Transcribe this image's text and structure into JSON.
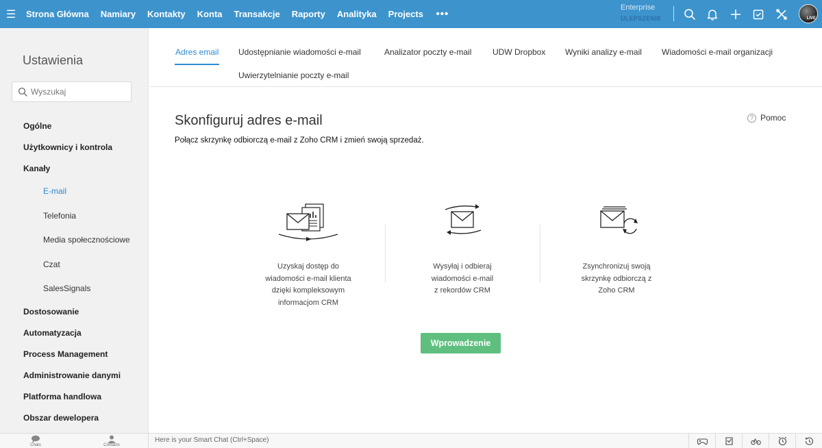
{
  "topnav": {
    "items": [
      "Strona Główna",
      "Namiary",
      "Kontakty",
      "Konta",
      "Transakcje",
      "Raporty",
      "Analityka",
      "Projects"
    ],
    "more": "•••",
    "edition": "Enterprise",
    "upgrade": "ULEPSZENIE",
    "icons": [
      "search-icon",
      "bell-icon",
      "plus-icon",
      "calendar-icon",
      "tools-icon"
    ],
    "avatar_badge": "LIVE"
  },
  "sidebar": {
    "title": "Ustawienia",
    "search_placeholder": "Wyszukaj",
    "items": [
      {
        "label": "Ogólne"
      },
      {
        "label": "Użytkownicy i kontrola"
      },
      {
        "label": "Kanały"
      }
    ],
    "subitems": [
      "E-mail",
      "Telefonia",
      "Media społecznościowe",
      "Czat",
      "SalesSignals"
    ],
    "items_after": [
      "Dostosowanie",
      "Automatyzacja",
      "Process Management",
      "Administrowanie danymi",
      "Platforma handlowa",
      "Obszar dewelopera"
    ]
  },
  "tabs": [
    "Adres email",
    "Udostępnianie wiadomości e-mail",
    "Analizator poczty e-mail",
    "UDW Dropbox",
    "Wyniki analizy e-mail",
    "Wiadomości e-mail organizacji",
    "Uwierzytelnianie poczty e-mail"
  ],
  "main": {
    "title": "Skonfiguruj adres e-mail",
    "subtitle": "Połącz skrzynkę odbiorczą e-mail z Zoho CRM i zmień swoją sprzedaż.",
    "help": "Pomoc",
    "help_glyph": "?",
    "features": [
      {
        "line1": "Uzyskaj dostęp do",
        "line2": "wiadomości e-mail klienta",
        "line3": "dzięki kompleksowym",
        "line4": "informacjom CRM"
      },
      {
        "line1": "Wysyłaj i odbieraj",
        "line2": "wiadomości e-mail",
        "line3": "z rekordów CRM",
        "line4": ""
      },
      {
        "line1": "Zsynchronizuj swoją",
        "line2": "skrzynkę odbiorczą z",
        "line3": "Zoho CRM",
        "line4": ""
      }
    ],
    "cta": "Wprowadzenie"
  },
  "bottombar": {
    "chats": "Chats",
    "contacts": "Contacts",
    "smart_chat": "Here is your Smart Chat (Ctrl+Space)"
  }
}
